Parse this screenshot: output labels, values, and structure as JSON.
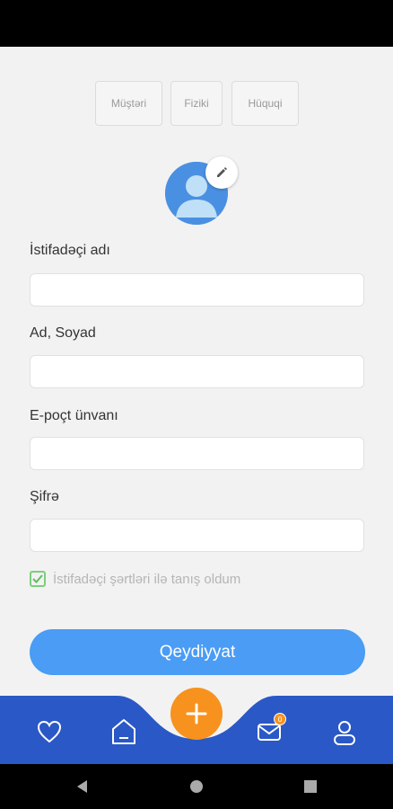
{
  "account_types": [
    "Müştəri",
    "Fiziki",
    "Hüquqi"
  ],
  "form": {
    "username_label": "İstifadəçi adı",
    "username_value": "",
    "fullname_label": "Ad, Soyad",
    "fullname_value": "",
    "email_label": "E-poçt ünvanı",
    "email_value": "",
    "password_label": "Şifrə",
    "password_value": "",
    "terms_text": "İstifadəçi şərtləri ilə tanış oldum",
    "terms_checked": true,
    "submit_label": "Qeydiyyat"
  },
  "bottom_nav": {
    "items": [
      "heart-icon",
      "home-icon",
      "plus-icon",
      "mail-icon",
      "user-icon"
    ],
    "mail_badge": "0"
  },
  "colors": {
    "primary_blue": "#4a9cf5",
    "nav_blue": "#2a58c6",
    "fab_orange": "#f7921e",
    "check_green": "#7bcf7b"
  }
}
